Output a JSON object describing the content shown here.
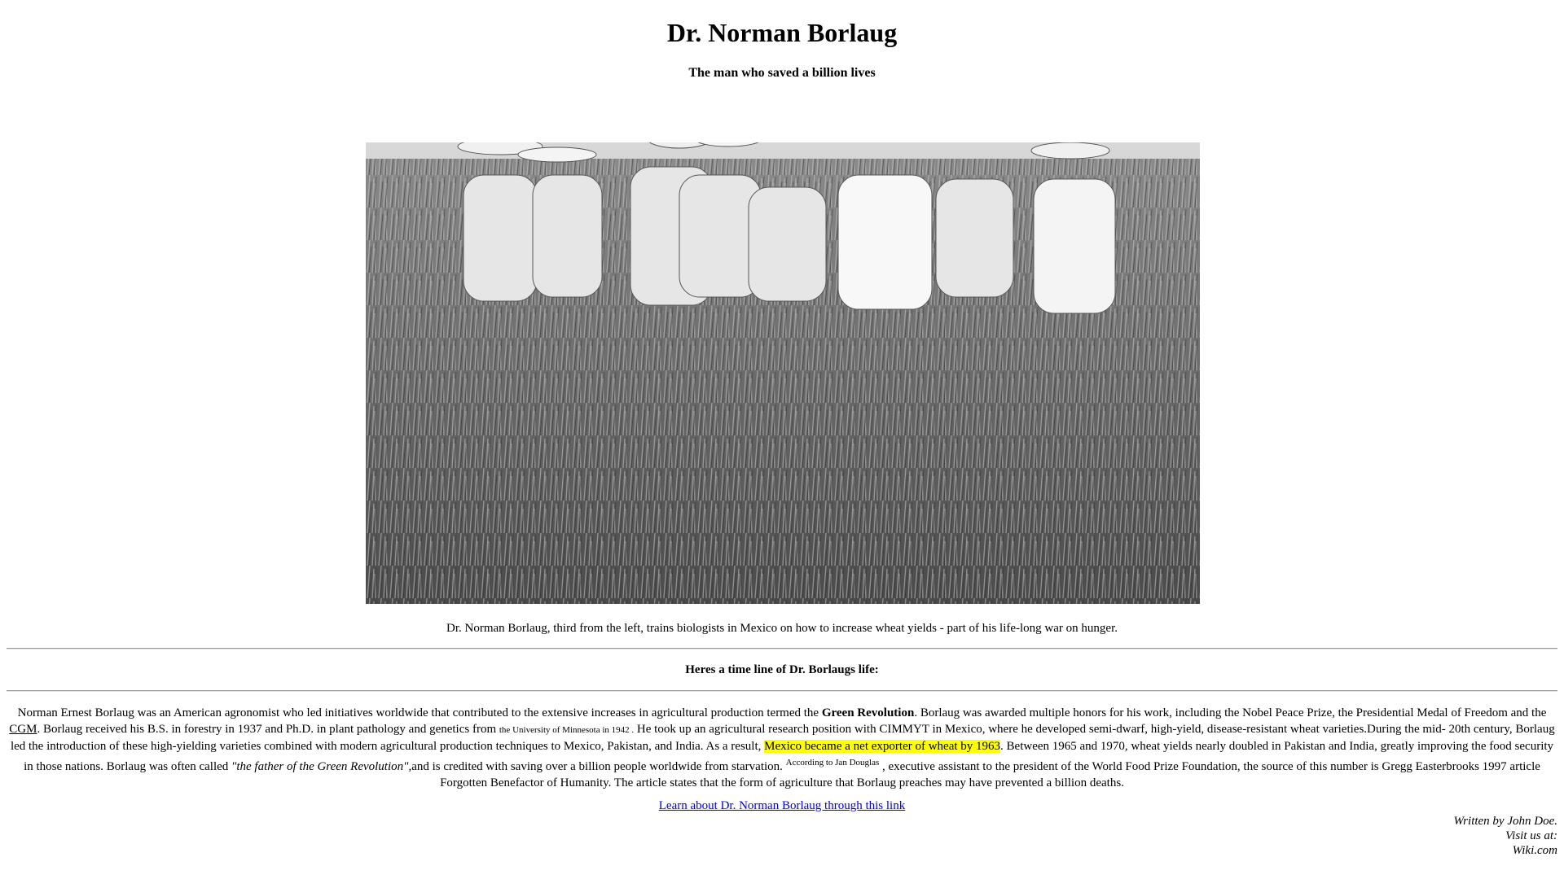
{
  "page": {
    "title": "Dr. Norman Borlaug",
    "subtitle": "The man who saved a billion lives"
  },
  "figure": {
    "caption": "Dr. Norman Borlaug, third from the left, trains biologists in Mexico on how to increase wheat yields - part of his life-long war on hunger."
  },
  "timeline": {
    "heading": "Heres a time line of Dr. Borlaugs life:"
  },
  "bio": {
    "p1": "Norman Ernest Borlaug was an American agronomist who led initiatives worldwide that contributed to the extensive increases in agricultural production termed the ",
    "green_revolution": "Green Revolution",
    "p2": ". Borlaug was awarded multiple honors for his work, including the Nobel Peace Prize, the Presidential Medal of Freedom and the ",
    "cgm_link": "CGM",
    "p3": ". Borlaug received his B.S. in forestry in 1937 and Ph.D. in plant pathology and genetics from ",
    "university_small": "the University of Minnesota in 1942 .",
    "p4": " He took up an agricultural research position with CIMMYT in Mexico, where he developed semi-dwarf, high-yield, disease-resistant wheat varieties.During the mid- 20th century, Borlaug led the introduction of these high-yielding varieties combined with modern agricultural production techniques to Mexico, Pakistan, and India. As a result, ",
    "highlight": "Mexico became a net exporter of wheat by 1963",
    "p5": ". Between 1965 and 1970, wheat yields nearly doubled in Pakistan and India, greatly improving the food security in those nations. Borlaug was often called ",
    "quote": "\"the father of the Green Revolution\"",
    "p6": ",and is credited with saving over a billion people worldwide from starvation. ",
    "source_small": "According to Jan Douglas",
    "p7": " , executive assistant to the president of the World Food Prize Foundation, the source of this number is Gregg Easterbrooks 1997 article Forgotten Benefactor of Humanity. The article states that the form of agriculture that Borlaug preaches may have prevented a billion deaths."
  },
  "learn_link": "Learn about Dr. Norman Borlaug through this link",
  "credits": {
    "line1": "Written by John Doe.",
    "line2": "Visit us at:",
    "line3": "Wiki.com"
  },
  "colors": {
    "highlight": "#ffff00",
    "link": "#0000ee"
  }
}
